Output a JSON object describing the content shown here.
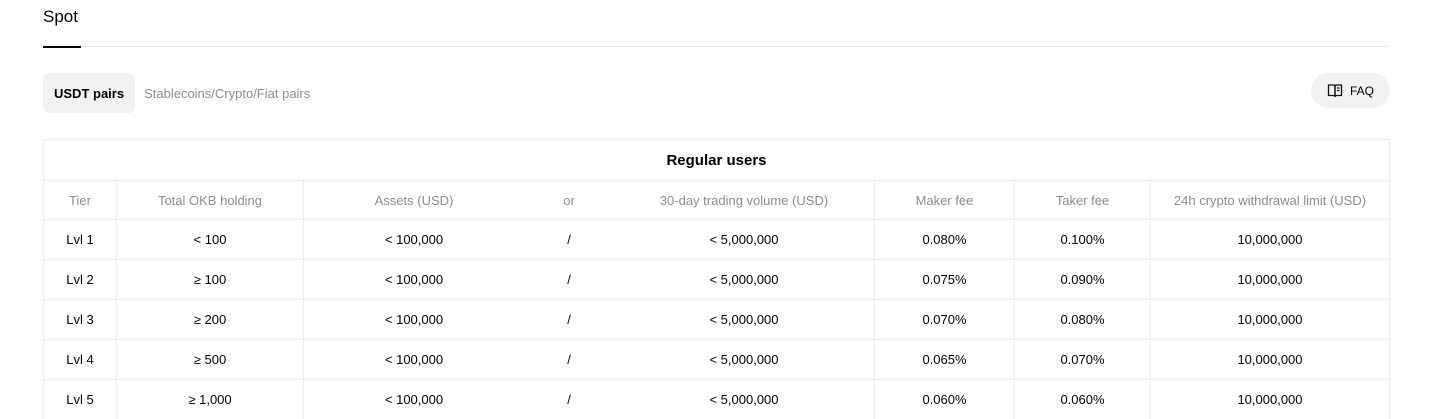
{
  "section_tabs": [
    {
      "label": "Spot",
      "active": true
    }
  ],
  "filters": [
    {
      "label": "USDT pairs",
      "active": true
    },
    {
      "label": "Stablecoins/Crypto/Fiat pairs",
      "active": false
    }
  ],
  "faq": {
    "label": "FAQ",
    "icon": "book-icon"
  },
  "table": {
    "title": "Regular users",
    "headers": {
      "tier": "Tier",
      "okb": "Total OKB holding",
      "assets": "Assets (USD)",
      "or": "or",
      "volume": "30-day trading volume (USD)",
      "maker": "Maker fee",
      "taker": "Taker fee",
      "limit": "24h crypto withdrawal limit (USD)"
    },
    "rows": [
      {
        "tier": "Lvl 1",
        "okb": "< 100",
        "assets": "< 100,000",
        "or": "/",
        "volume": "< 5,000,000",
        "maker": "0.080%",
        "taker": "0.100%",
        "limit": "10,000,000"
      },
      {
        "tier": "Lvl 2",
        "okb": "≥ 100",
        "assets": "< 100,000",
        "or": "/",
        "volume": "< 5,000,000",
        "maker": "0.075%",
        "taker": "0.090%",
        "limit": "10,000,000"
      },
      {
        "tier": "Lvl 3",
        "okb": "≥ 200",
        "assets": "< 100,000",
        "or": "/",
        "volume": "< 5,000,000",
        "maker": "0.070%",
        "taker": "0.080%",
        "limit": "10,000,000"
      },
      {
        "tier": "Lvl 4",
        "okb": "≥ 500",
        "assets": "< 100,000",
        "or": "/",
        "volume": "< 5,000,000",
        "maker": "0.065%",
        "taker": "0.070%",
        "limit": "10,000,000"
      },
      {
        "tier": "Lvl 5",
        "okb": "≥ 1,000",
        "assets": "< 100,000",
        "or": "/",
        "volume": "< 5,000,000",
        "maker": "0.060%",
        "taker": "0.060%",
        "limit": "10,000,000"
      }
    ]
  }
}
